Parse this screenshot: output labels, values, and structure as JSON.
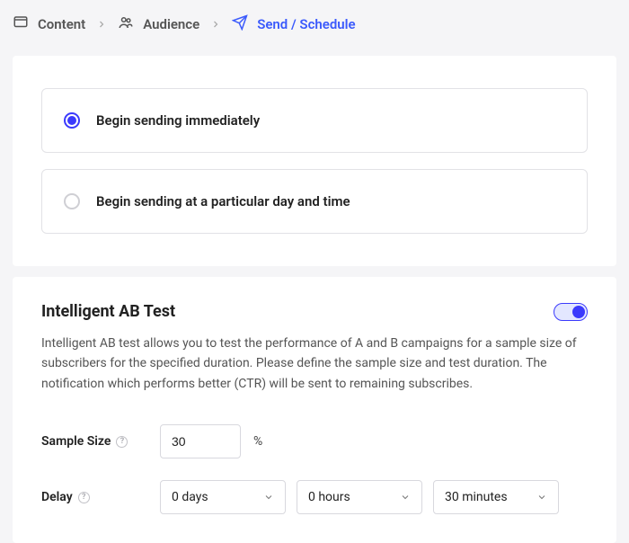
{
  "breadcrumb": {
    "items": [
      {
        "label": "Content"
      },
      {
        "label": "Audience"
      },
      {
        "label": "Send / Schedule"
      }
    ]
  },
  "scheduling": {
    "option_immediate": {
      "label": "Begin sending immediately"
    },
    "option_later": {
      "label": "Begin sending at a particular day and time"
    }
  },
  "abTest": {
    "title": "Intelligent AB Test",
    "description": "Intelligent AB test allows you to test the performance of A and B campaigns for a sample size of subscribers for the specified duration. Please define the sample size and test duration. The notification which performs better (CTR) will be sent to remaining subscribes.",
    "fields": {
      "sample_size": {
        "label": "Sample Size",
        "value": "30",
        "unit": "%"
      },
      "delay": {
        "label": "Delay",
        "days": "0 days",
        "hours": "0 hours",
        "minutes": "30 minutes"
      }
    }
  }
}
